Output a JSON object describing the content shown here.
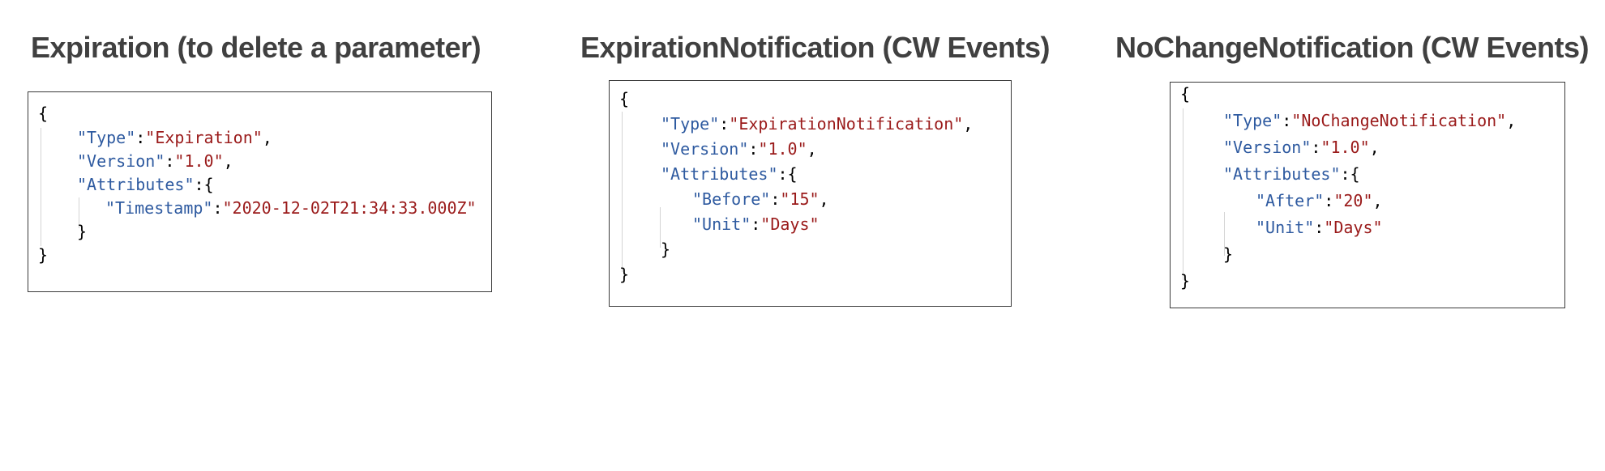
{
  "panels": [
    {
      "title": "Expiration (to delete a parameter)",
      "open_brace": "{",
      "close_brace": "}",
      "type_key": "\"Type\"",
      "type_value": "\"Expiration\"",
      "version_key": "\"Version\"",
      "version_value": "\"1.0\"",
      "attributes_key": "\"Attributes\"",
      "attributes_open": "{",
      "attributes_close": "}",
      "attr1_key": "\"Timestamp\"",
      "attr1_value": "\"2020-12-02T21:34:33.000Z\""
    },
    {
      "title": "ExpirationNotification (CW Events)",
      "open_brace": "{",
      "close_brace": "}",
      "type_key": "\"Type\"",
      "type_value": "\"ExpirationNotification\"",
      "version_key": "\"Version\"",
      "version_value": "\"1.0\"",
      "attributes_key": "\"Attributes\"",
      "attributes_open": "{",
      "attributes_close": "}",
      "attr1_key": "\"Before\"",
      "attr1_value": "\"15\"",
      "attr2_key": "\"Unit\"",
      "attr2_value": "\"Days\""
    },
    {
      "title": "NoChangeNotification (CW Events)",
      "open_brace": "{",
      "close_brace": "}",
      "type_key": "\"Type\"",
      "type_value": "\"NoChangeNotification\"",
      "version_key": "\"Version\"",
      "version_value": "\"1.0\"",
      "attributes_key": "\"Attributes\"",
      "attributes_open": "{",
      "attributes_close": "}",
      "attr1_key": "\"After\"",
      "attr1_value": "\"20\"",
      "attr2_key": "\"Unit\"",
      "attr2_value": "\"Days\""
    }
  ],
  "colors": {
    "title": "#404040",
    "key": "#2e5aa0",
    "string": "#9a1a1a",
    "border": "#3a3a3a"
  }
}
